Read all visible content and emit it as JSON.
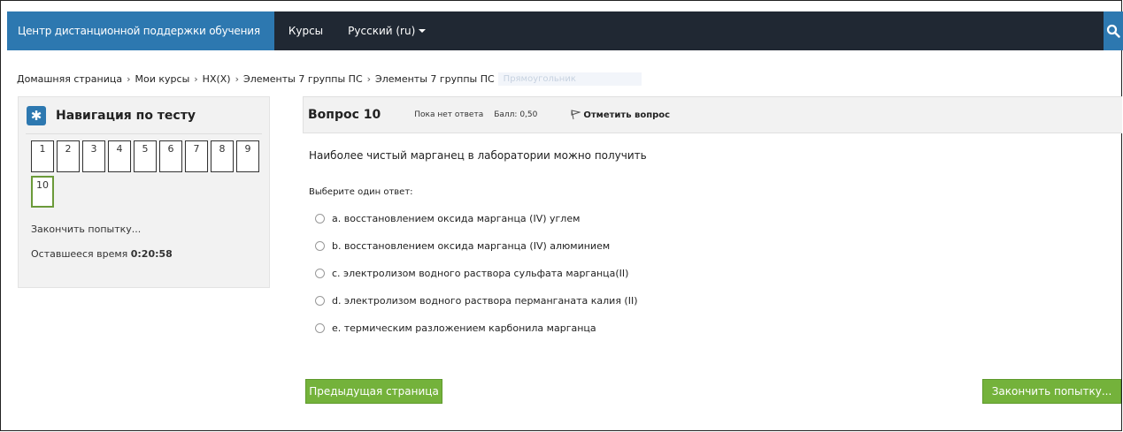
{
  "navbar": {
    "brand": "Центр дистанционной поддержки обучения",
    "courses": "Курсы",
    "language": "Русский (ru)"
  },
  "breadcrumb": {
    "items": [
      "Домашняя страница",
      "Мои курсы",
      "НХ(Х)",
      "Элементы 7 группы ПС",
      "Элементы 7 группы ПС"
    ],
    "ghost": "Прямоугольник"
  },
  "quiznav": {
    "title": "Навигация по тесту",
    "buttons": [
      "1",
      "2",
      "3",
      "4",
      "5",
      "6",
      "7",
      "8",
      "9",
      "10"
    ],
    "finish_link": "Закончить попытку...",
    "time_label": "Оставшееся время",
    "time_value": "0:20:58"
  },
  "question": {
    "number_label": "Вопрос 10",
    "state": "Пока нет ответа",
    "grade": "Балл: 0,50",
    "flag_label": "Отметить вопрос",
    "text": "Наиболее чистый марганец в лаборатории можно получить",
    "prompt": "Выберите один ответ:",
    "answers": [
      "a. восстановлением оксида марганца (IV) углем",
      "b. восстановлением оксида марганца (IV) алюминием",
      "c. электролизом  водного раствора сульфата марганца(II)",
      "d. электролизом  водного раствора перманганата калия (II)",
      "e. термическим разложением карбонила марганца"
    ]
  },
  "footer": {
    "prev_button": "Предыдущая страница",
    "finish_button": "Закончить попытку..."
  },
  "colors": {
    "navbar_bg": "#202833",
    "brand_bg": "#2d78b0",
    "button_green": "#74b23b"
  }
}
